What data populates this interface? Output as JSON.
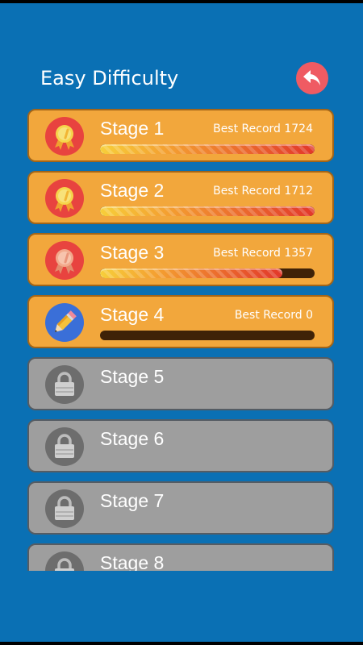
{
  "header": {
    "title": "Easy Difficulty",
    "back_icon": "undo-arrow-icon"
  },
  "colors": {
    "background": "#0a70b4",
    "card_unlocked": "#f2a73c",
    "card_locked": "#9e9e9e",
    "back_button": "#ef5b63"
  },
  "stages": [
    {
      "label": "Stage 1",
      "status": "completed",
      "medal": "gold",
      "best_record": "Best Record 1724",
      "progress": 1.0
    },
    {
      "label": "Stage 2",
      "status": "completed",
      "medal": "gold",
      "best_record": "Best Record 1712",
      "progress": 1.0
    },
    {
      "label": "Stage 3",
      "status": "completed",
      "medal": "bronze",
      "best_record": "Best Record 1357",
      "progress": 0.85
    },
    {
      "label": "Stage 4",
      "status": "current",
      "medal": "pencil",
      "best_record": "Best Record 0",
      "progress": 0.0
    },
    {
      "label": "Stage 5",
      "status": "locked"
    },
    {
      "label": "Stage 6",
      "status": "locked"
    },
    {
      "label": "Stage 7",
      "status": "locked"
    },
    {
      "label": "Stage 8",
      "status": "locked"
    }
  ]
}
